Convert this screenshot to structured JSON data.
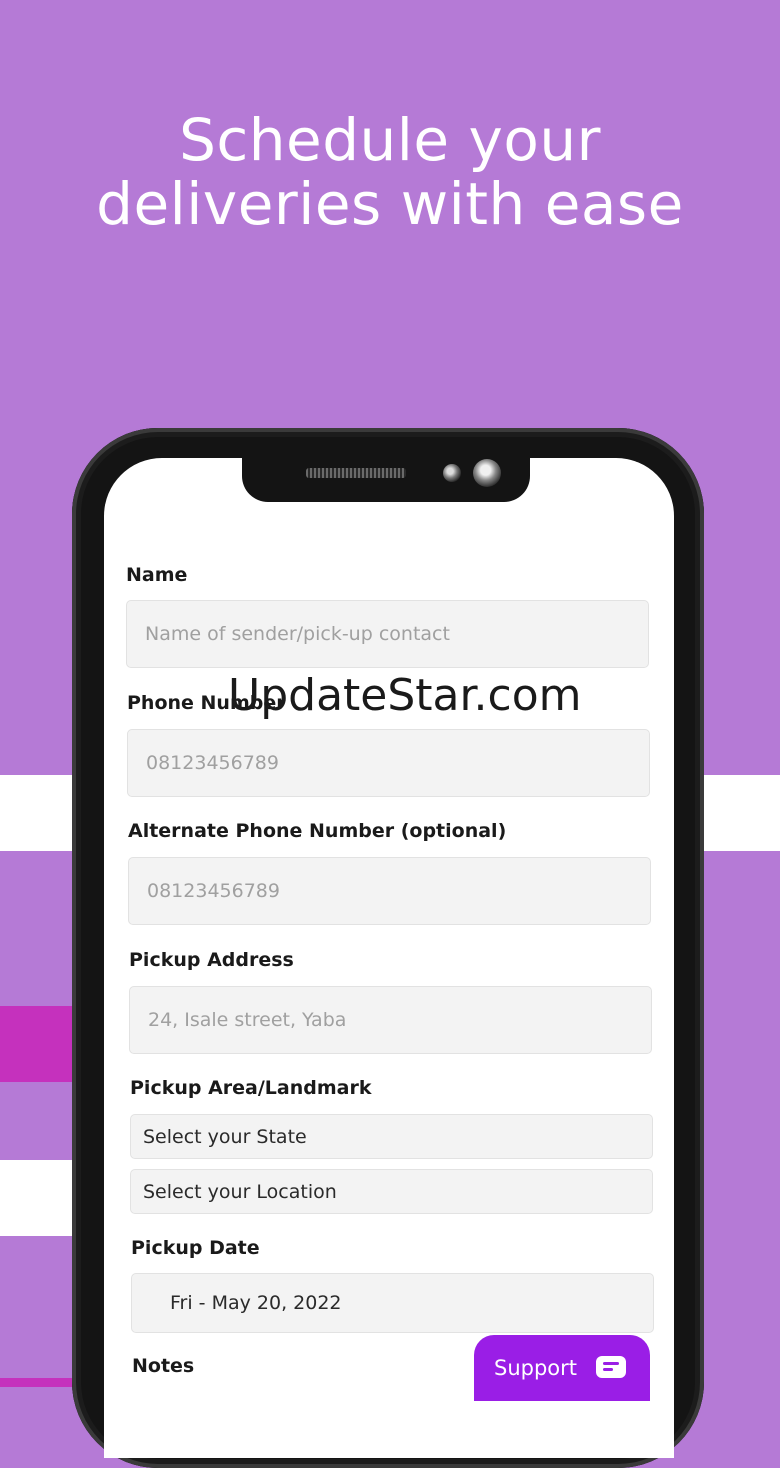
{
  "headline": {
    "line1": "Schedule your",
    "line2": "deliveries with ease"
  },
  "watermark": "UpdateStar.com",
  "form": {
    "name": {
      "label": "Name",
      "placeholder": "Name of sender/pick-up contact"
    },
    "phone": {
      "label": "Phone Number",
      "placeholder": "08123456789"
    },
    "alt_phone": {
      "label": "Alternate Phone Number (optional)",
      "placeholder": "08123456789"
    },
    "pickup_address": {
      "label": "Pickup Address",
      "placeholder": "24, Isale street, Yaba"
    },
    "pickup_area": {
      "label": "Pickup Area/Landmark",
      "state": "Select your State",
      "location": "Select your Location"
    },
    "pickup_date": {
      "label": "Pickup Date",
      "value": "Fri - May 20, 2022"
    },
    "notes": {
      "label": "Notes"
    }
  },
  "support": {
    "label": "Support"
  },
  "colors": {
    "background": "#b57ad6",
    "accent": "#9a1ee6",
    "stripe_magenta": "#c531bd"
  }
}
